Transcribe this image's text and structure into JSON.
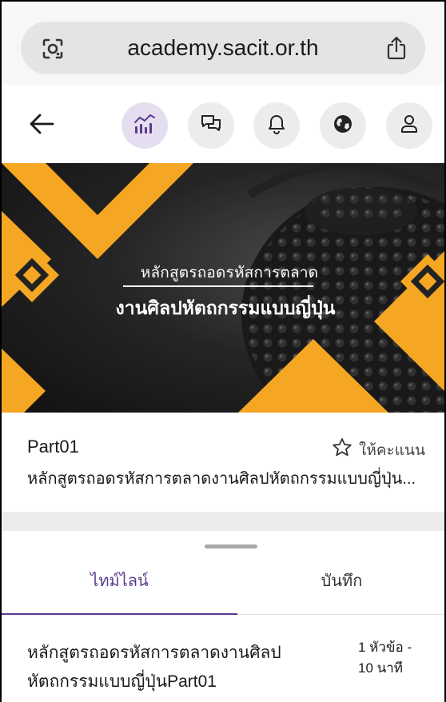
{
  "browser": {
    "url": "academy.sacit.or.th"
  },
  "toolbar": {
    "icons": [
      "back-arrow-icon",
      "chart-icon",
      "chat-icon",
      "bell-icon",
      "globe-icon",
      "user-icon"
    ],
    "active_color": "#e5def0"
  },
  "banner": {
    "subtitle": "หลักสูตรถอดรหัสการตลาด",
    "title": "งานศิลปหัตถกรรมแบบญี่ปุ่น",
    "accent_color": "#f5a623"
  },
  "course": {
    "part_title": "Part01",
    "rate_label": "ให้คะแนน",
    "description": "หลักสูตรถอดรหัสการตลาดงานศิลปหัตถกรรมแบบญี่ปุ่น..."
  },
  "tabs": {
    "timeline_label": "ไทม์ไลน์",
    "notes_label": "บันทึก",
    "active_color": "#5b3a8f"
  },
  "lesson": {
    "title": "หลักสูตรถอดรหัสการตลาดงานศิลปหัตถกรรมแบบญี่ปุ่นPart01",
    "topics": "1 หัวข้อ -",
    "duration": "10 นาที"
  }
}
